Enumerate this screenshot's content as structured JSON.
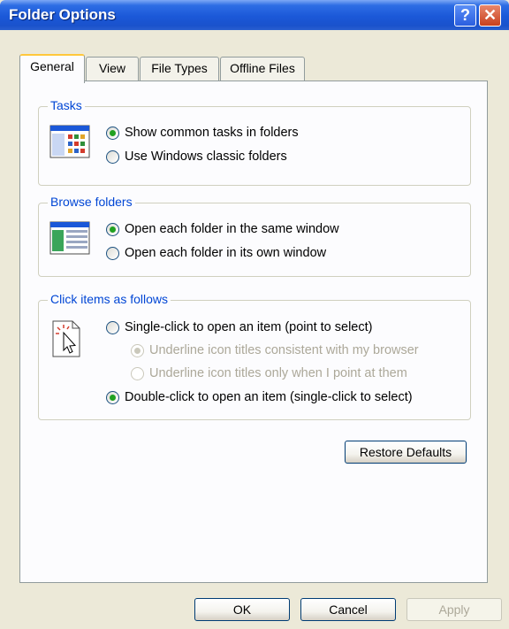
{
  "window": {
    "title": "Folder Options",
    "help_glyph": "?",
    "close_glyph": "✕"
  },
  "tabs": [
    {
      "label": "General",
      "active": true
    },
    {
      "label": "View",
      "active": false
    },
    {
      "label": "File Types",
      "active": false
    },
    {
      "label": "Offline Files",
      "active": false
    }
  ],
  "tasks": {
    "label": "Tasks",
    "options": [
      {
        "label": "Show common tasks in folders",
        "checked": true
      },
      {
        "label": "Use Windows classic folders",
        "checked": false
      }
    ]
  },
  "browse": {
    "label": "Browse folders",
    "options": [
      {
        "label": "Open each folder in the same window",
        "checked": true
      },
      {
        "label": "Open each folder in its own window",
        "checked": false
      }
    ]
  },
  "click": {
    "label": "Click items as follows",
    "single": {
      "label": "Single-click to open an item (point to select)",
      "checked": false
    },
    "sub_options": [
      {
        "label": "Underline icon titles consistent with my browser",
        "checked": true,
        "disabled": true
      },
      {
        "label": "Underline icon titles only when I point at them",
        "checked": false,
        "disabled": true
      }
    ],
    "double": {
      "label": "Double-click to open an item (single-click to select)",
      "checked": true
    }
  },
  "buttons": {
    "restore": "Restore Defaults",
    "ok": "OK",
    "cancel": "Cancel",
    "apply": "Apply"
  },
  "colors": {
    "title_bar": "#1b58d8",
    "group_label": "#0046d5",
    "radio_checked": "#21a121",
    "active_tab_highlight": "#ffc83c"
  }
}
